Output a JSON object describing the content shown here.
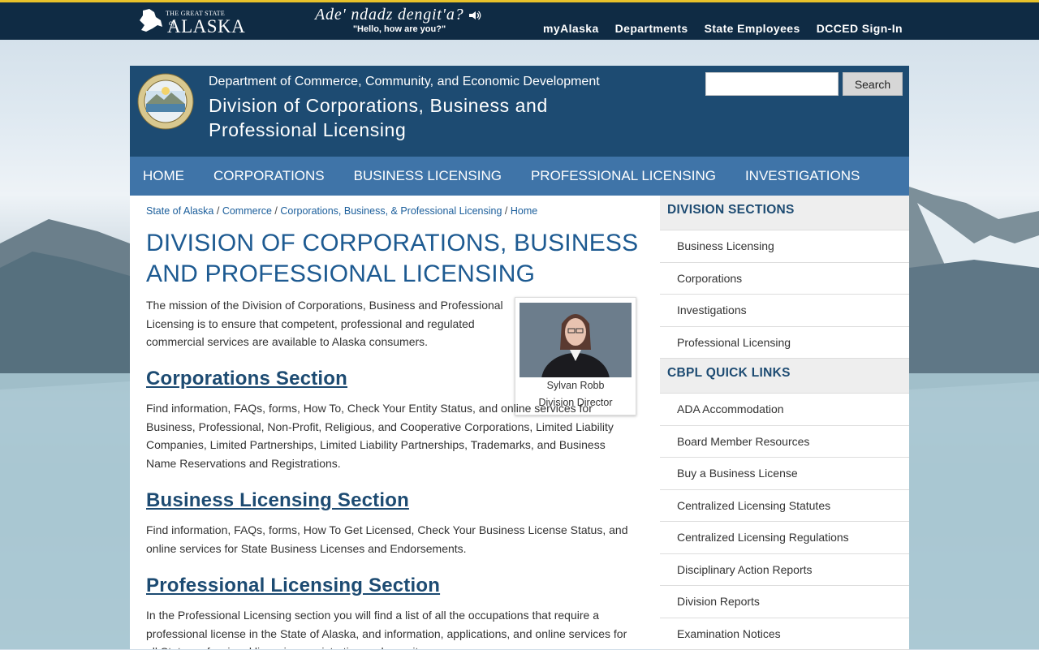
{
  "topbar": {
    "logo_small": "THE GREAT STATE",
    "logo_of": "of",
    "logo_big": "ALASKA",
    "native_phrase": "Ade' ndadz dengit'a?",
    "native_translation": "\"Hello, how are you?\"",
    "nav": [
      "myAlaska",
      "Departments",
      "State Employees",
      "DCCED Sign-In"
    ]
  },
  "header": {
    "department": "Department of Commerce, Community, and Economic Development",
    "division": "Division of Corporations, Business and Professional Licensing",
    "search_placeholder": "",
    "search_button": "Search"
  },
  "mainnav": [
    "HOME",
    "CORPORATIONS",
    "BUSINESS LICENSING",
    "PROFESSIONAL LICENSING",
    "INVESTIGATIONS"
  ],
  "breadcrumb": [
    "State of Alaska",
    "Commerce",
    "Corporations, Business, & Professional Licensing",
    "Home"
  ],
  "main": {
    "title": "DIVISION OF CORPORATIONS, BUSINESS AND PROFESSIONAL LICENSING",
    "mission": "The mission of the Division of Corporations, Business and Professional Licensing is to ensure that competent, professional and regulated commercial services are available to Alaska consumers.",
    "director_name": "Sylvan Robb",
    "director_title": "Division Director",
    "sections": [
      {
        "title": "Corporations Section",
        "text": "Find information, FAQs, forms, How To, Check Your Entity Status, and online services for Business, Professional, Non-Profit, Religious, and Cooperative Corporations, Limited Liability Companies, Limited Partnerships, Limited Liability Partnerships, Trademarks, and Business Name Reservations and Registrations."
      },
      {
        "title": "Business Licensing Section",
        "text": "Find information, FAQs, forms, How To Get Licensed, Check Your Business License Status, and online services for State Business Licenses and Endorsements."
      },
      {
        "title": "Professional Licensing Section",
        "text": "In the Professional Licensing section you will find a list of all the occupations that require a professional license in the State of Alaska, and information, applications, and online services for all State professional licensing, registration and permits."
      }
    ]
  },
  "sidebar": {
    "division_sections_title": "DIVISION SECTIONS",
    "division_sections": [
      "Business Licensing",
      "Corporations",
      "Investigations",
      "Professional Licensing"
    ],
    "quick_links_title": "CBPL QUICK LINKS",
    "quick_links": [
      "ADA Accommodation",
      "Board Member Resources",
      "Buy a Business License",
      "Centralized Licensing Statutes",
      "Centralized Licensing Regulations",
      "Disciplinary Action Reports",
      "Division Reports",
      "Examination Notices"
    ]
  },
  "colors": {
    "topbar": "#0f2b44",
    "topbar_accent": "#e8c22a",
    "header": "#1d4b72",
    "nav": "#3f74a8",
    "link": "#1b5e9b",
    "title": "#1d5a91"
  },
  "icons": [
    "alaska-logo",
    "speaker-icon",
    "state-seal-icon",
    "director-portrait"
  ]
}
